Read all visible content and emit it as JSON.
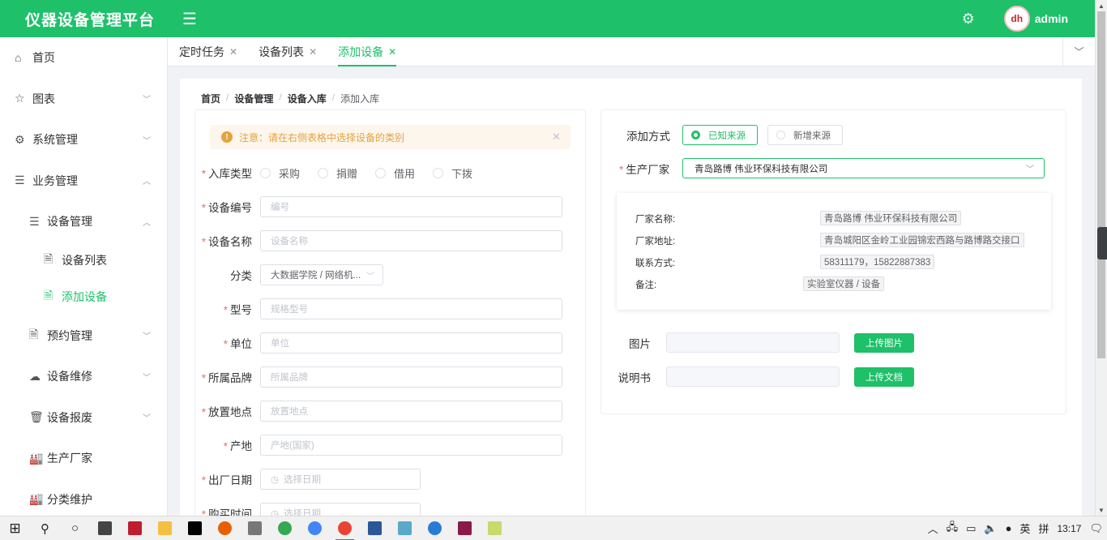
{
  "app": {
    "brand": "仪器设备管理平台",
    "user": "admin",
    "avatar_text": "dh"
  },
  "sidebar": {
    "items": [
      {
        "label": "首页",
        "icon": "home-icon"
      },
      {
        "label": "图表",
        "icon": "star-icon"
      },
      {
        "label": "系统管理",
        "icon": "gear-icon"
      },
      {
        "label": "业务管理",
        "icon": "menu-icon"
      },
      {
        "label": "设备管理",
        "icon": "menu-icon"
      },
      {
        "label": "设备列表",
        "icon": "document-icon"
      },
      {
        "label": "添加设备",
        "icon": "document-add-icon"
      },
      {
        "label": "预约管理",
        "icon": "document-icon"
      },
      {
        "label": "设备维修",
        "icon": "cloud-icon"
      },
      {
        "label": "设备报废",
        "icon": "trash-icon"
      },
      {
        "label": "生产厂家",
        "icon": "factory-icon"
      },
      {
        "label": "分类维护",
        "icon": "factory-icon"
      }
    ],
    "active": "添加设备"
  },
  "tabs": [
    {
      "label": "定时任务"
    },
    {
      "label": "设备列表"
    },
    {
      "label": "添加设备",
      "active": true
    }
  ],
  "breadcrumb": [
    "首页",
    "设备管理",
    "设备入库",
    "添加入库"
  ],
  "form": {
    "alert": "注意：请在右侧表格中选择设备的类别",
    "inbound_type": {
      "label": "入库类型",
      "options": [
        "采购",
        "捐赠",
        "借用",
        "下拨"
      ]
    },
    "device_no": {
      "label": "设备编号",
      "placeholder": "编号"
    },
    "device_name": {
      "label": "设备名称",
      "placeholder": "设备名称"
    },
    "category": {
      "label": "分类",
      "value": "大数据学院 / 网络机..."
    },
    "model": {
      "label": "型号",
      "placeholder": "规格型号"
    },
    "unit": {
      "label": "单位",
      "placeholder": "单位"
    },
    "brand": {
      "label": "所属品牌",
      "placeholder": "所属品牌"
    },
    "location": {
      "label": "放置地点",
      "placeholder": "放置地点"
    },
    "origin": {
      "label": "产地",
      "placeholder": "产地(国家)"
    },
    "factory_date": {
      "label": "出厂日期",
      "placeholder": "选择日期"
    },
    "purchase_date": {
      "label": "购买时间",
      "placeholder": "选择日期"
    }
  },
  "source": {
    "label": "添加方式",
    "options": [
      "已知来源",
      "新增来源"
    ],
    "selected": "已知来源",
    "manufacturer_label": "生产厂家",
    "manufacturer_value": "青岛路博 伟业环保科技有限公司",
    "info": {
      "name_label": "厂家名称:",
      "name": "青岛路博 伟业环保科技有限公司",
      "address_label": "厂家地址:",
      "address": "青岛城阳区金岭工业园锦宏西路与路博路交接口",
      "contact_label": "联系方式:",
      "contact": "58311179，15822887383",
      "remark_label": "备注:",
      "remark": "实验室仪器 / 设备"
    },
    "image_label": "图片",
    "image_button": "上传图片",
    "manual_label": "说明书",
    "manual_button": "上传文档"
  },
  "taskbar": {
    "ime_lang": "英",
    "ime_mode": "拼",
    "time": "13:17"
  },
  "colors": {
    "primary": "#1ec069",
    "warning": "#e6a23c",
    "required": "#f56c6c"
  }
}
